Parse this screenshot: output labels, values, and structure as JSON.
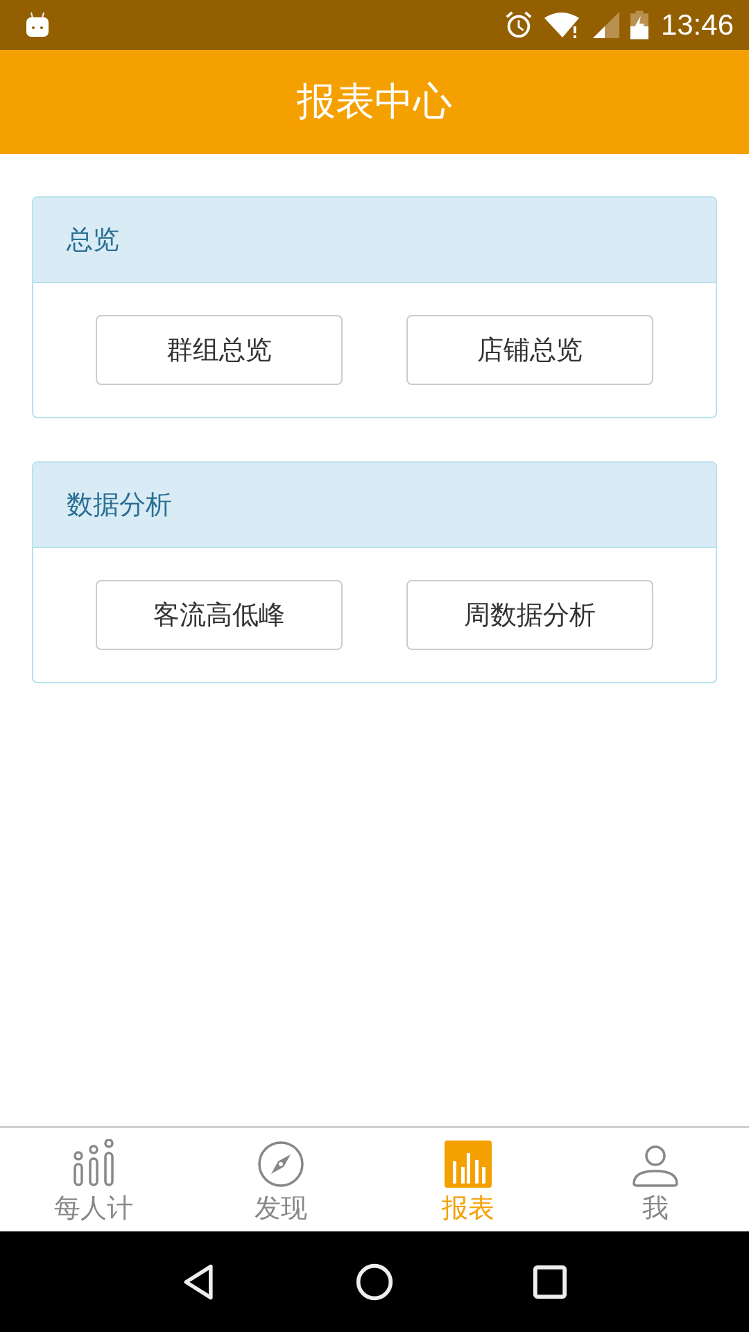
{
  "status_bar": {
    "time": "13:46"
  },
  "header": {
    "title": "报表中心"
  },
  "sections": [
    {
      "title": "总览",
      "buttons": [
        "群组总览",
        "店铺总览"
      ]
    },
    {
      "title": "数据分析",
      "buttons": [
        "客流高低峰",
        "周数据分析"
      ]
    }
  ],
  "bottom_nav": [
    {
      "kind": "dots",
      "label": "每人计",
      "selected": false
    },
    {
      "kind": "compass",
      "label": "发现",
      "selected": false
    },
    {
      "kind": "chart",
      "label": "报表",
      "selected": true
    },
    {
      "kind": "person",
      "label": "我",
      "selected": false
    }
  ]
}
